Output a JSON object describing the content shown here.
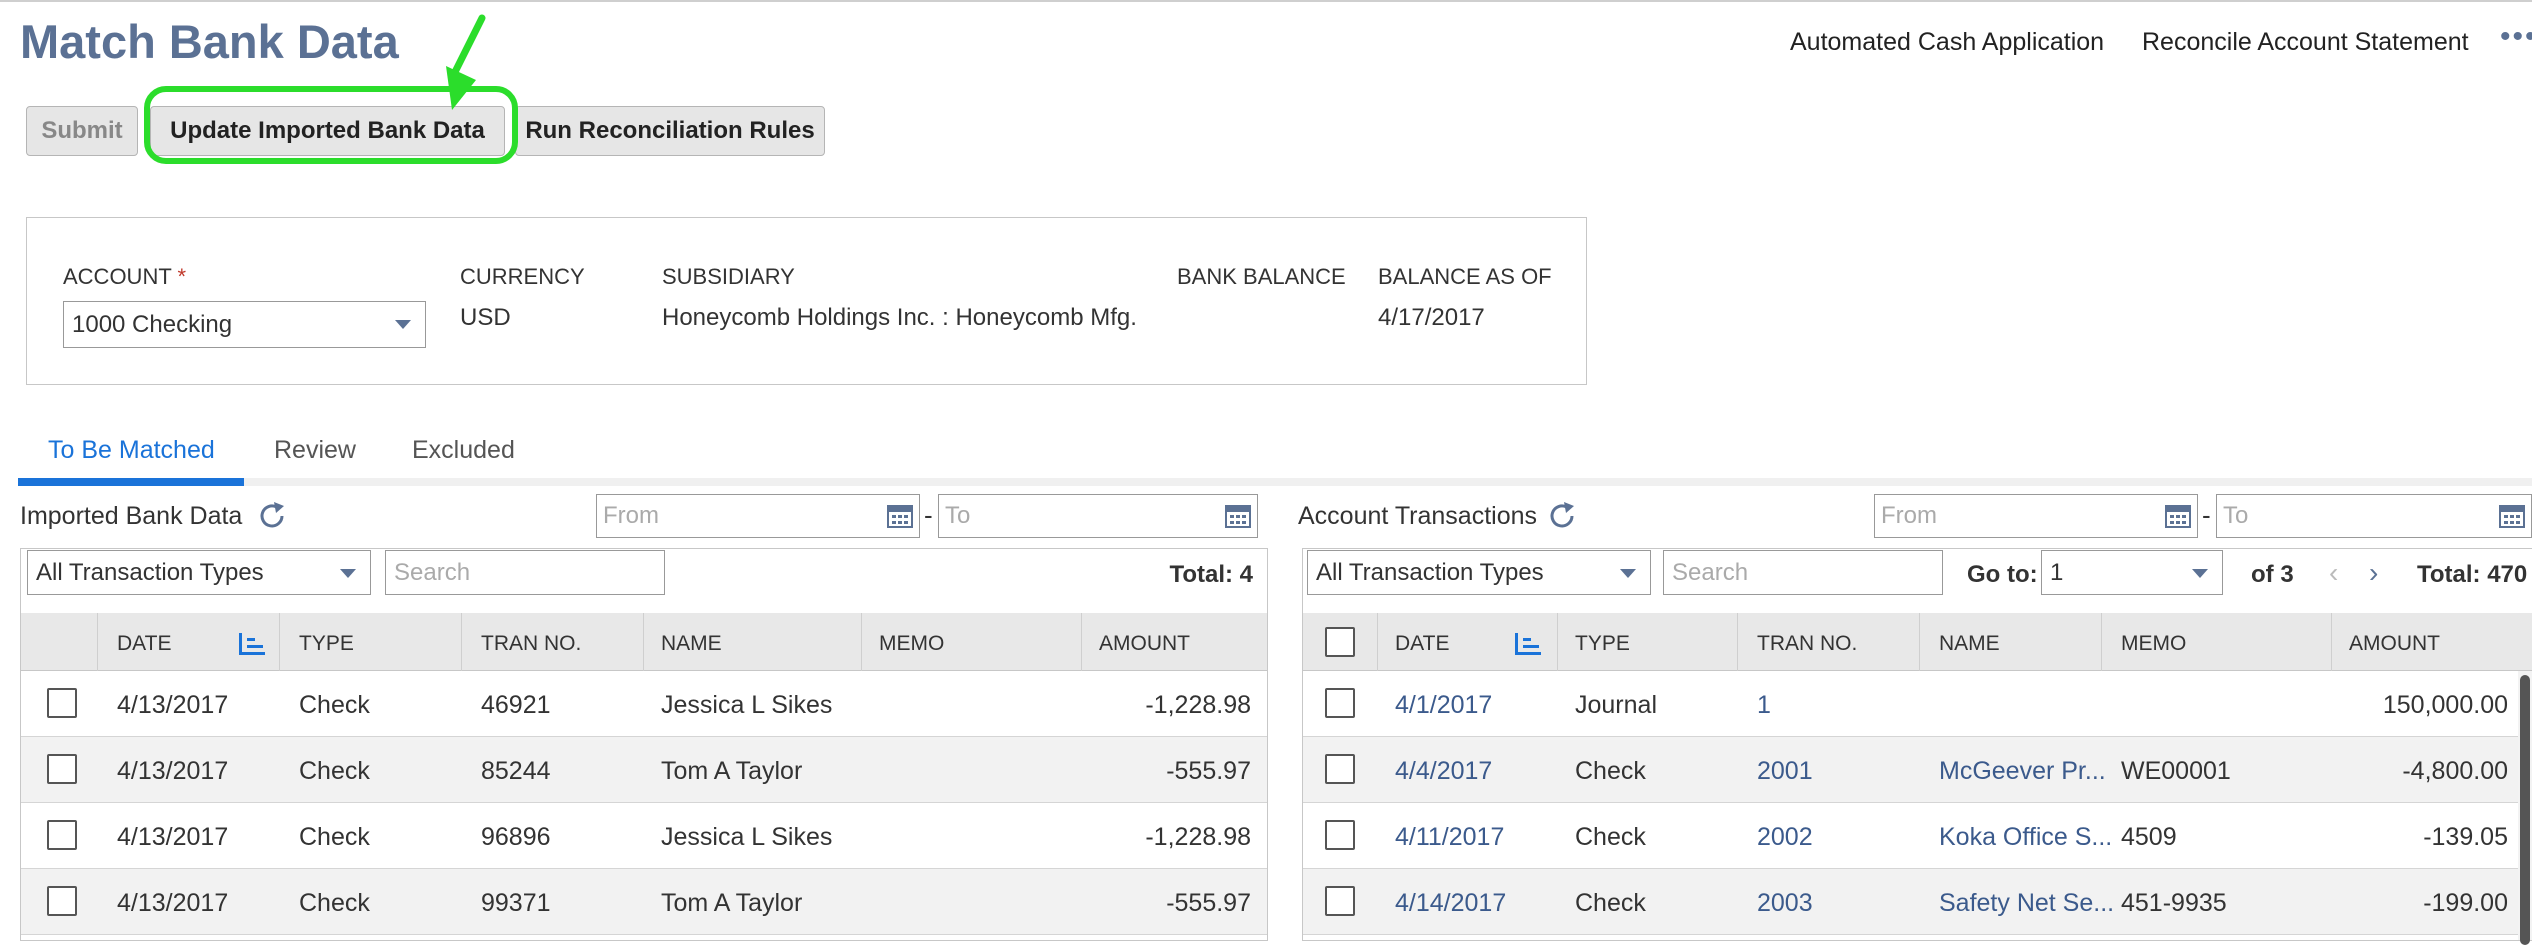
{
  "page": {
    "title": "Match Bank Data",
    "links": [
      "Automated Cash Application",
      "Reconcile Account Statement"
    ],
    "more": "•••"
  },
  "toolbar": {
    "submit": "Submit",
    "update_imported": "Update Imported Bank Data",
    "run_rules": "Run Reconciliation Rules"
  },
  "annotation": {
    "color": "#2bdd2b"
  },
  "account_info": {
    "account_label": "ACCOUNT",
    "account_required": "*",
    "account_value": "1000 Checking",
    "currency_label": "CURRENCY",
    "currency_value": "USD",
    "subsidiary_label": "SUBSIDIARY",
    "subsidiary_value": "Honeycomb Holdings Inc. : Honeycomb Mfg.",
    "bank_balance_label": "BANK BALANCE",
    "bank_balance_value": "",
    "balance_as_of_label": "BALANCE AS OF",
    "balance_as_of_value": "4/17/2017"
  },
  "tabs": [
    {
      "label": "To Be Matched",
      "active": true
    },
    {
      "label": "Review",
      "active": false
    },
    {
      "label": "Excluded",
      "active": false
    }
  ],
  "imported": {
    "title": "Imported Bank Data",
    "from_placeholder": "From",
    "to_placeholder": "To",
    "type_filter": "All Transaction Types",
    "search_placeholder": "Search",
    "total": "Total: 4",
    "columns": [
      "DATE",
      "TYPE",
      "TRAN NO.",
      "NAME",
      "MEMO",
      "AMOUNT"
    ],
    "rows": [
      {
        "date": "4/13/2017",
        "type": "Check",
        "tran": "46921",
        "name": "Jessica L Sikes",
        "memo": "",
        "amount": "-1,228.98"
      },
      {
        "date": "4/13/2017",
        "type": "Check",
        "tran": "85244",
        "name": "Tom A Taylor",
        "memo": "",
        "amount": "-555.97"
      },
      {
        "date": "4/13/2017",
        "type": "Check",
        "tran": "96896",
        "name": "Jessica L Sikes",
        "memo": "",
        "amount": "-1,228.98"
      },
      {
        "date": "4/13/2017",
        "type": "Check",
        "tran": "99371",
        "name": "Tom A Taylor",
        "memo": "",
        "amount": "-555.97"
      }
    ]
  },
  "account_tx": {
    "title": "Account Transactions",
    "from_placeholder": "From",
    "to_placeholder": "To",
    "type_filter": "All Transaction Types",
    "search_placeholder": "Search",
    "goto_label": "Go to:",
    "goto_value": "1",
    "of_pages": "of 3",
    "prev": "‹",
    "next": "›",
    "total": "Total: 470",
    "columns": [
      "DATE",
      "TYPE",
      "TRAN NO.",
      "NAME",
      "MEMO",
      "AMOUNT"
    ],
    "rows": [
      {
        "date": "4/1/2017",
        "type": "Journal",
        "tran": "1",
        "name": "",
        "memo": "",
        "amount": "150,000.00"
      },
      {
        "date": "4/4/2017",
        "type": "Check",
        "tran": "2001",
        "name": "McGeever Pr...",
        "memo": "WE00001",
        "amount": "-4,800.00"
      },
      {
        "date": "4/11/2017",
        "type": "Check",
        "tran": "2002",
        "name": "Koka Office S...",
        "memo": "4509",
        "amount": "-139.05"
      },
      {
        "date": "4/14/2017",
        "type": "Check",
        "tran": "2003",
        "name": "Safety Net Se...",
        "memo": "451-9935",
        "amount": "-199.00"
      }
    ]
  }
}
